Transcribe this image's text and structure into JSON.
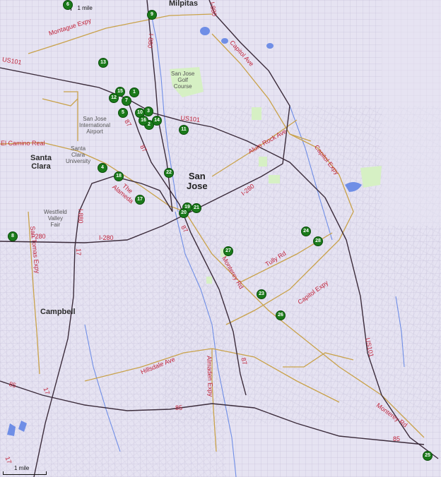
{
  "cities": {
    "milpitas": "Milpitas",
    "san_jose_line1": "San",
    "san_jose_line2": "Jose",
    "santa_clara_line1": "Santa",
    "santa_clara_line2": "Clara",
    "campbell": "Campbell"
  },
  "places": {
    "golf_line1": "San Jose",
    "golf_line2": "Golf",
    "golf_line3": "Course",
    "airport_line1": "San Jose",
    "airport_line2": "International",
    "airport_line3": "Airport",
    "scu_line1": "Santa",
    "scu_line2": "Clara",
    "scu_line3": "University",
    "valley_fair_line1": "Westfield",
    "valley_fair_line2": "Valley",
    "valley_fair_line3": "Fair"
  },
  "roads": {
    "montague": "Montague Expy",
    "us101_nw": "US101",
    "us101_mid": "US101",
    "us101_se": "US101",
    "el_camino": "El Camino Real",
    "alameda_line1": "The",
    "alameda_line2": "Alameda",
    "i880_n": "I-880",
    "i880_n2": "I-880",
    "i880_w": "I-880",
    "i280_w": "I-280",
    "i280_e": "I-280",
    "i280_ne": "I-280",
    "capitol_ave": "Capitol Ave",
    "alum_rock": "Alum Rock Ave",
    "capitol_expy_n": "Capitol Expy",
    "capitol_expy_s": "Capitol Expy",
    "tully": "Tully Rd",
    "monterey_n": "Monterey Rd",
    "monterey_s": "Monterey Rd",
    "san_tomas": "San Tomas Expy",
    "hillsdale": "Hillsdale Ave",
    "almaden": "Almaden Expy",
    "sr87_a": "87",
    "sr87_b": "87",
    "sr87_c": "87",
    "sr87_d": "87",
    "sr17_a": "17",
    "sr17_b": "17",
    "sr17_c": "17",
    "sr85_a": "85",
    "sr85_b": "85",
    "sr85_c": "85"
  },
  "scale": {
    "top": "1 mile",
    "bottom": "1 mile"
  },
  "markers": [
    "1",
    "2",
    "3",
    "4",
    "5",
    "6",
    "7",
    "8",
    "9",
    "10",
    "11",
    "12",
    "13",
    "14",
    "15",
    "16",
    "17",
    "18",
    "19",
    "20",
    "21",
    "22",
    "23",
    "24",
    "25",
    "26",
    "27",
    "28"
  ],
  "colors": {
    "background": "#e6e3f2",
    "streets": "#b9b4cf",
    "highway": "#3b2b3a",
    "expressway": "#c9a24a",
    "water": "#6f8ee6",
    "park": "#d6f0c4",
    "marker": "#1a7a1a"
  }
}
